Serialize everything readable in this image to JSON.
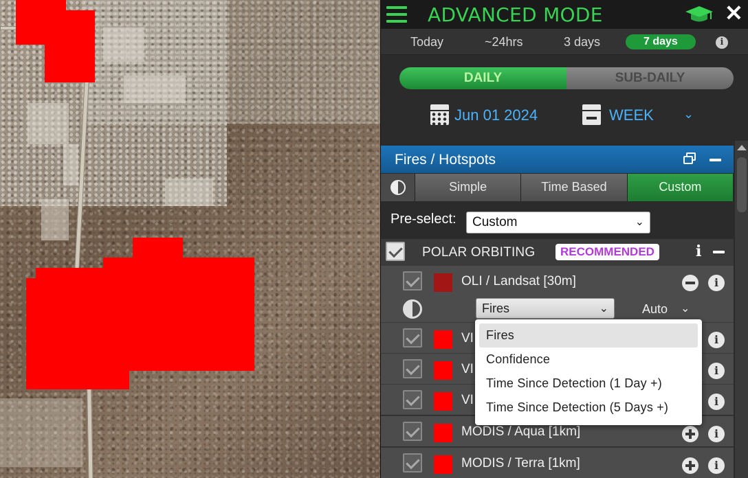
{
  "header": {
    "title": "ADVANCED MODE",
    "menu_icon": "hamburger-icon",
    "education_icon": "graduation-cap-icon",
    "close_icon": "close-icon",
    "accent_color": "#39d353"
  },
  "time_range": {
    "options": [
      "Today",
      "~24hrs",
      "3 days",
      "7 days"
    ],
    "selected": "7 days",
    "info_icon": "info-icon"
  },
  "mode_toggle": {
    "daily_label": "DAILY",
    "subdaily_label": "SUB-DAILY",
    "selected": "DAILY"
  },
  "date_bar": {
    "date": "Jun 01 2024",
    "period": "WEEK",
    "date_color": "#4ab3ff"
  },
  "layer": {
    "title": "Fires / Hotspots",
    "header_color": "#1c74b8",
    "tabs": [
      "Simple",
      "Time Based",
      "Custom"
    ],
    "active_tab": "Custom",
    "preselect_label": "Pre-select:",
    "preselect_value": "Custom",
    "group": {
      "title": "POLAR ORBITING",
      "badge": "RECOMMENDED",
      "badge_color": "#b23ad8"
    },
    "sensors": [
      {
        "name": "OLI / Landsat [30m]",
        "color": "#a31616",
        "action": "remove"
      },
      {
        "name": "VI",
        "color": "#ff0000",
        "action": "add"
      },
      {
        "name": "VI",
        "color": "#ff0000",
        "action": "add"
      },
      {
        "name": "VI",
        "color": "#ff0000",
        "action": "add"
      },
      {
        "name": "MODIS / Aqua [1km]",
        "color": "#ff0000",
        "action": "add"
      },
      {
        "name": "MODIS / Terra [1km]",
        "color": "#ff0000",
        "action": "add"
      }
    ],
    "style_select_value": "Fires",
    "scale_label": "Auto",
    "style_options": [
      "Fires",
      "Confidence",
      "Time Since Detection (1 Day +)",
      "Time Since Detection (5 Days +)"
    ],
    "highlighted_option": "Fires"
  },
  "map": {
    "fire_color": "#ff0000"
  }
}
